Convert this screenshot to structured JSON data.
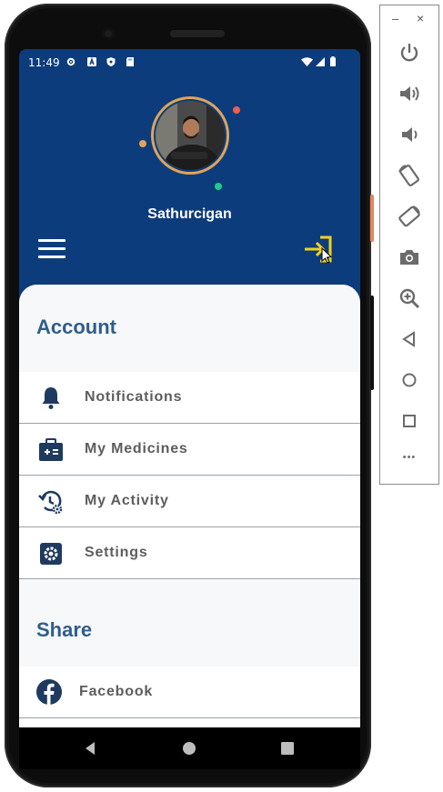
{
  "status_bar": {
    "time": "11:49"
  },
  "profile": {
    "name": "Sathurcigan"
  },
  "sections": [
    {
      "title": "Account",
      "items": [
        {
          "label": "Notifications",
          "icon": "bell-icon"
        },
        {
          "label": "My Medicines",
          "icon": "medicine-kit-icon"
        },
        {
          "label": "My Activity",
          "icon": "activity-history-icon"
        },
        {
          "label": "Settings",
          "icon": "gear-icon"
        }
      ]
    },
    {
      "title": "Share",
      "items": [
        {
          "label": "Facebook",
          "icon": "facebook-icon"
        }
      ]
    }
  ],
  "emulator_tools": {
    "window_controls": {
      "minimize": "–",
      "close": "×"
    },
    "buttons": [
      "power-icon",
      "volume-up-icon",
      "volume-down-icon",
      "rotate-left-icon",
      "rotate-right-icon",
      "camera-icon",
      "zoom-icon",
      "back-icon",
      "home-icon",
      "overview-icon",
      "more-icon"
    ],
    "more_label": "•••"
  },
  "colors": {
    "header_bg": "#0d3c7c",
    "accent_yellow": "#f2d21b",
    "title_blue": "#2f5e8c",
    "icon_navy": "#1e3a5f",
    "ring_orange": "#e0a458",
    "dot_red": "#e9614b",
    "dot_green": "#1fc98a"
  }
}
